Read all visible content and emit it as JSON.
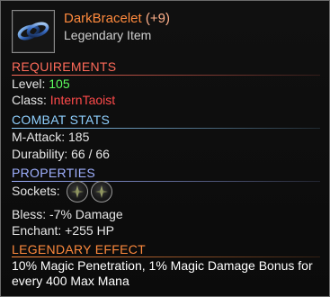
{
  "item": {
    "name": "DarkBracelet",
    "enhance": "(+9)",
    "type": "Legendary Item"
  },
  "requirements": {
    "title": "REQUIREMENTS",
    "level_label": "Level:",
    "level_value": "105",
    "class_label": "Class:",
    "class_value": "InternTaoist"
  },
  "combat": {
    "title": "COMBAT STATS",
    "mattack": "M-Attack: 185",
    "durability": "Durability: 66 / 66"
  },
  "properties": {
    "title": "PROPERTIES",
    "sockets_label": "Sockets:",
    "bless": "Bless: -7% Damage",
    "enchant": "Enchant: +255 HP"
  },
  "legendary": {
    "title": "LEGENDARY EFFECT",
    "text": "10% Magic Penetration, 1% Magic Damage Bonus for every 400 Max Mana"
  },
  "colors": {
    "requirements_title": "#ff6b5a",
    "combat_title": "#8fd0ff",
    "properties_title": "#9fb0ff",
    "legendary_title": "#ff8a3d"
  },
  "icons": {
    "item": "bracelet-icon",
    "socket": "empty-socket-icon"
  }
}
